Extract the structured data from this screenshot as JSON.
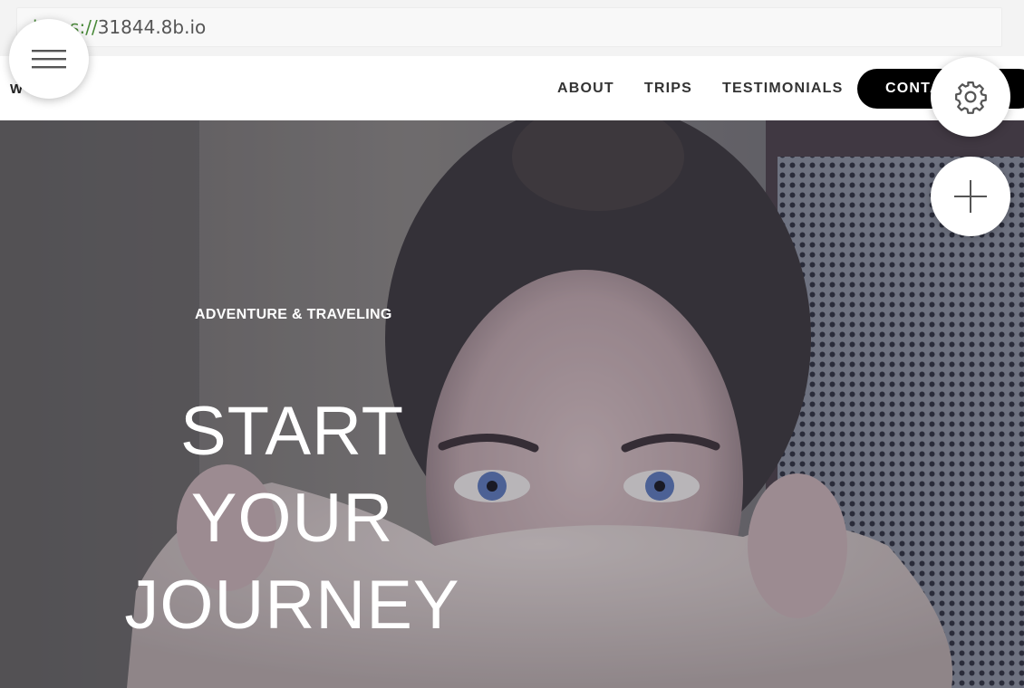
{
  "browser": {
    "url_scheme": "https://",
    "url_host": "31844.8b.io"
  },
  "navbar": {
    "logo_text": "W",
    "links": [
      {
        "label": "ABOUT"
      },
      {
        "label": "TRIPS"
      },
      {
        "label": "TESTIMONIALS"
      }
    ],
    "contact_label": "CONTACT"
  },
  "hero": {
    "subtitle": "ADVENTURE & TRAVELING",
    "title_lines": [
      "START",
      "YOUR",
      "JOURNEY"
    ]
  },
  "icons": {
    "menu": "hamburger-menu-icon",
    "settings": "gear-icon",
    "add": "plus-icon"
  }
}
